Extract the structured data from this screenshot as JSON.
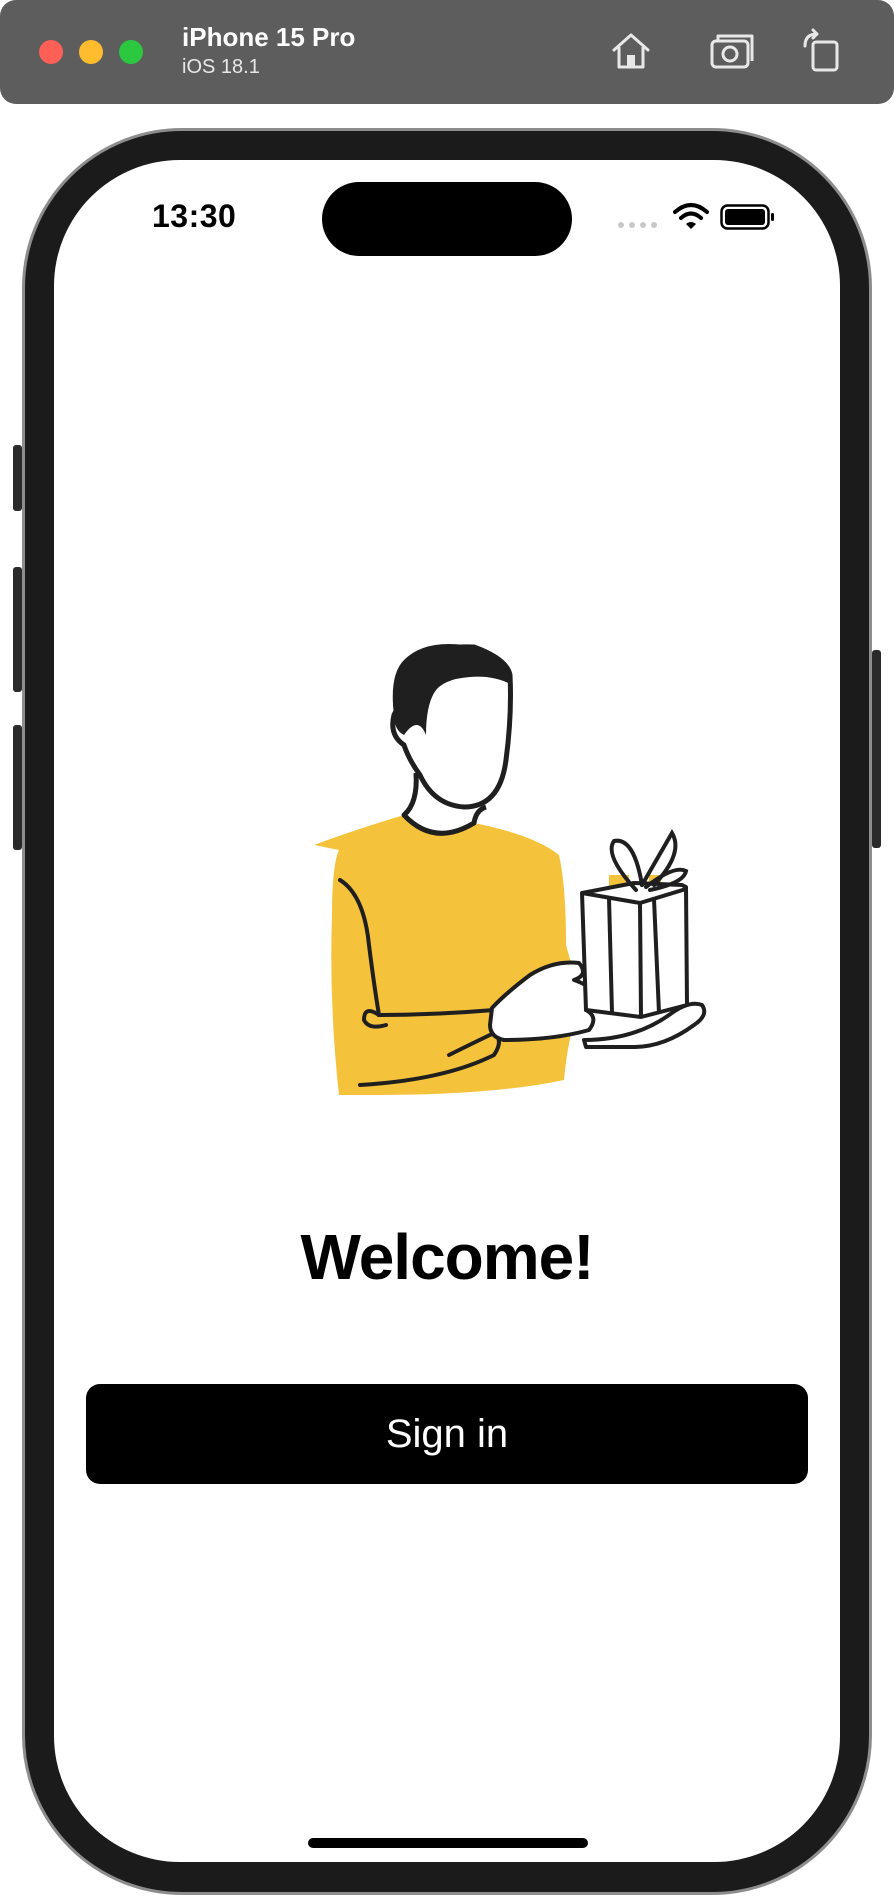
{
  "simulator": {
    "device_name": "iPhone 15 Pro",
    "os_version": "iOS 18.1",
    "icons": [
      "home-icon",
      "screenshot-icon",
      "rotate-icon"
    ]
  },
  "status_bar": {
    "time": "13:30",
    "icons": [
      "signal-dots-icon",
      "wifi-icon",
      "battery-icon"
    ]
  },
  "welcome_screen": {
    "illustration": "person-holding-gift-illustration",
    "title": "Welcome!",
    "sign_in_label": "Sign in"
  },
  "colors": {
    "accent": "#f5c33b",
    "button_bg": "#000000",
    "button_text": "#ffffff",
    "titlebar": "#5d5d5d"
  }
}
